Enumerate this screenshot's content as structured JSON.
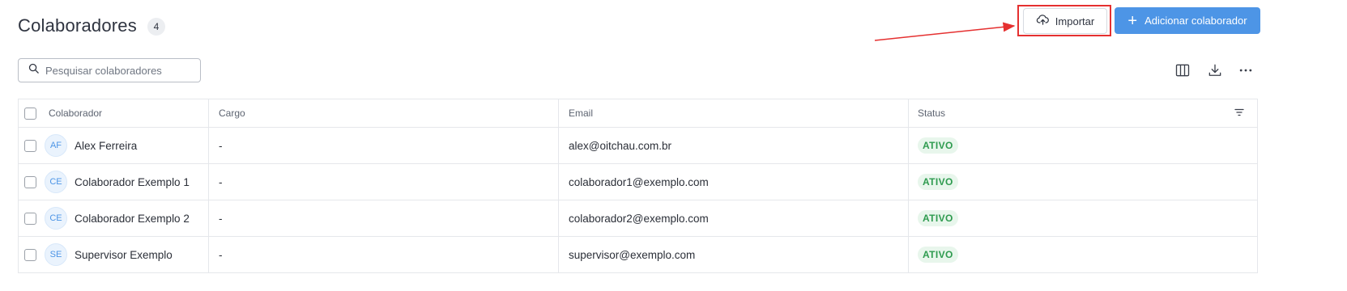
{
  "header": {
    "title": "Colaboradores",
    "count": "4",
    "import_label": "Importar",
    "add_label": "Adicionar colaborador"
  },
  "search": {
    "placeholder": "Pesquisar colaboradores",
    "value": ""
  },
  "toolbar": {
    "icons": [
      "columns-icon",
      "download-icon",
      "more-icon"
    ]
  },
  "table": {
    "columns": [
      "Colaborador",
      "Cargo",
      "Email",
      "Status"
    ],
    "rows": [
      {
        "initials": "AF",
        "name": "Alex Ferreira",
        "cargo": "-",
        "email": "alex@oitchau.com.br",
        "status": "ATIVO"
      },
      {
        "initials": "CE",
        "name": "Colaborador Exemplo 1",
        "cargo": "-",
        "email": "colaborador1@exemplo.com",
        "status": "ATIVO"
      },
      {
        "initials": "CE",
        "name": "Colaborador Exemplo 2",
        "cargo": "-",
        "email": "colaborador2@exemplo.com",
        "status": "ATIVO"
      },
      {
        "initials": "SE",
        "name": "Supervisor Exemplo",
        "cargo": "-",
        "email": "supervisor@exemplo.com",
        "status": "ATIVO"
      }
    ]
  },
  "colors": {
    "accent": "#4d95e6",
    "status_active_text": "#2e9b4f",
    "status_active_bg": "#e8f6ec",
    "annotation": "#e53030"
  }
}
